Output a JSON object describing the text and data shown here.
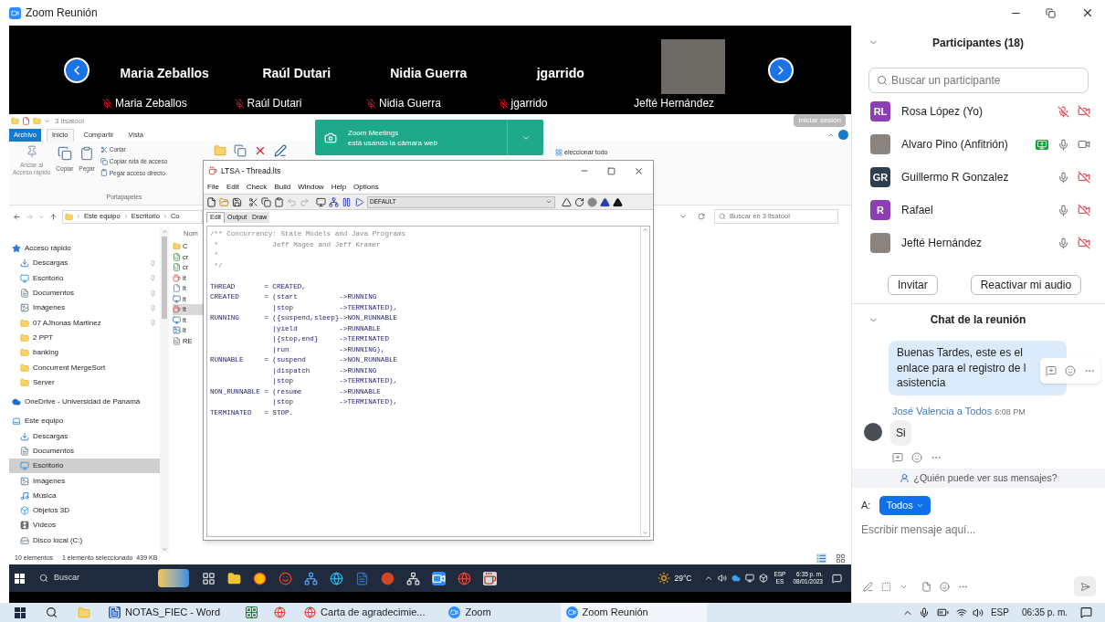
{
  "window": {
    "title": "Zoom Reunión"
  },
  "video_strip": {
    "tiles": [
      {
        "kind": "name",
        "name": "Maria Zeballos",
        "label": "Maria Zeballos",
        "muted": true
      },
      {
        "kind": "name",
        "name": "Raúl Dutari",
        "label": "Raúl Dutari",
        "muted": true
      },
      {
        "kind": "name",
        "name": "Nidia Guerra",
        "label": "Nidia Guerra",
        "muted": true
      },
      {
        "kind": "name",
        "name": "jgarrido",
        "label": "jgarrido",
        "muted": true
      },
      {
        "kind": "video",
        "label": "Jefté Hernández",
        "muted": false
      }
    ]
  },
  "shared_screen": {
    "explorer": {
      "title": "3 ltsatool",
      "ribbon_tabs": [
        {
          "label": "Archivo",
          "kind": "file",
          "selected": false
        },
        {
          "label": "Inicio",
          "kind": "tab",
          "selected": true
        },
        {
          "label": "Compartir",
          "kind": "tab",
          "selected": false
        },
        {
          "label": "Vista",
          "kind": "tab",
          "selected": false
        }
      ],
      "clipboard": {
        "pin": "Anclar al\nAcceso rápido",
        "copy": "Copiar",
        "paste": "Pegar",
        "cut": "Cortar",
        "copy_path": "Copiar ruta de acceso",
        "paste_shortcut": "Pegar acceso directo",
        "group": "Portapapeles"
      },
      "select_all": "eleccionar todo",
      "sign_in": "Iniciar sesión",
      "address": [
        "Este equipo",
        "Escritorio",
        "Co"
      ],
      "search_placeholder": "Buscar en 3 ltsatool",
      "nav": [
        {
          "label": "Acceso rápido",
          "kind": "star",
          "pinned": false,
          "selected": false,
          "children": [
            {
              "label": "Descargas",
              "kind": "download",
              "pinned": true,
              "selected": false
            },
            {
              "label": "Escritorio",
              "kind": "desktop",
              "pinned": true,
              "selected": false
            },
            {
              "label": "Documentos",
              "kind": "document",
              "pinned": true,
              "selected": false
            },
            {
              "label": "Imágenes",
              "kind": "image",
              "pinned": true,
              "selected": false
            },
            {
              "label": "07 AJhonas Martinez",
              "kind": "folder",
              "pinned": true,
              "selected": false
            },
            {
              "label": "2 PPT",
              "kind": "folder",
              "pinned": false,
              "selected": false
            },
            {
              "label": "banking",
              "kind": "folder",
              "pinned": false,
              "selected": false
            },
            {
              "label": "Concurrent MergeSort",
              "kind": "folder",
              "pinned": false,
              "selected": false
            },
            {
              "label": "Server",
              "kind": "folder",
              "pinned": false,
              "selected": false
            }
          ]
        },
        {
          "label": "OneDrive - Universidad de Panamá",
          "kind": "cloud",
          "pinned": false,
          "selected": false
        },
        {
          "label": "Este equipo",
          "kind": "pc",
          "pinned": false,
          "selected": false,
          "children": [
            {
              "label": "Descargas",
              "kind": "download",
              "pinned": false,
              "selected": false
            },
            {
              "label": "Documentos",
              "kind": "document",
              "pinned": false,
              "selected": false
            },
            {
              "label": "Escritorio",
              "kind": "desktop",
              "pinned": false,
              "selected": true
            },
            {
              "label": "Imágenes",
              "kind": "image",
              "pinned": false,
              "selected": false
            },
            {
              "label": "Música",
              "kind": "music",
              "pinned": false,
              "selected": false
            },
            {
              "label": "Objetos 3D",
              "kind": "objects",
              "pinned": false,
              "selected": false
            },
            {
              "label": "Vídeos",
              "kind": "video",
              "pinned": false,
              "selected": false
            },
            {
              "label": "Disco local (C:)",
              "kind": "drive",
              "pinned": false,
              "selected": false
            }
          ]
        }
      ],
      "files": {
        "header": "Nom",
        "rows": [
          {
            "text": "C",
            "kind": "folder",
            "selected": false
          },
          {
            "text": "cr",
            "kind": "script",
            "selected": false
          },
          {
            "text": "cr",
            "kind": "script",
            "selected": false
          },
          {
            "text": "lt",
            "kind": "java",
            "selected": false
          },
          {
            "text": "lt",
            "kind": "file",
            "selected": false
          },
          {
            "text": "lt",
            "kind": "exe",
            "selected": false
          },
          {
            "text": "lt",
            "kind": "java",
            "selected": true
          },
          {
            "text": "lt",
            "kind": "exe",
            "selected": false
          },
          {
            "text": "lt",
            "kind": "image",
            "selected": false
          },
          {
            "text": "RE",
            "kind": "text",
            "selected": false
          }
        ]
      },
      "status": [
        "10 elementos",
        "1 elemento seleccionado  439 KB"
      ]
    },
    "notification": {
      "title": "Zoom Meetings",
      "text": "está usando la cámara web"
    },
    "ltsa": {
      "title": "LTSA - Thread.lts",
      "menu": [
        "File",
        "Edit",
        "Check",
        "Build",
        "Window",
        "Help",
        "Options"
      ],
      "target": "DEFAULT",
      "tabs": [
        {
          "label": "Edit",
          "selected": true
        },
        {
          "label": "Output",
          "selected": false
        },
        {
          "label": "Draw",
          "selected": false
        }
      ],
      "comment_lines": [
        "/** Concurrency: State Models and Java Programs",
        " *             Jeff Magee and Jeff Kramer",
        " *",
        " */"
      ],
      "code_lines": [
        "THREAD       = CREATED,",
        "CREATED      = (start          ->RUNNING",
        "               |stop           ->TERMINATED),",
        "RUNNING      = ({suspend,sleep}->NON_RUNNABLE",
        "               |yield          ->RUNNABLE",
        "               |{stop,end}     ->TERMINATED",
        "               |run            ->RUNNING),",
        "RUNNABLE     = (suspend        ->NON_RUNNABLE",
        "               |dispatch       ->RUNNING",
        "               |stop           ->TERMINATED),",
        "NON_RUNNABLE = (resume         ->RUNNABLE",
        "               |stop           ->TERMINATED),",
        "TERMINATED   = STOP."
      ]
    },
    "taskbar": {
      "search": "Buscar",
      "weather": "29°C",
      "lang": "ESP",
      "region": "ES",
      "time": "6:35 p. m.",
      "date": "08/01/2023"
    }
  },
  "participants": {
    "title": "Participantes (18)",
    "search_placeholder": "Buscar un participante",
    "rows": [
      {
        "name": "Rosa López (Yo)",
        "kind": "initials",
        "initials": "RL",
        "color": "#8c3fb5",
        "sharing": false,
        "muted": true,
        "camera_off": true
      },
      {
        "name": "Alvaro Pino (Anfitrión)",
        "kind": "photo",
        "sharing": true,
        "muted": false,
        "camera_off": false
      },
      {
        "name": "Guillermo R Gonzalez",
        "kind": "initials",
        "initials": "GR",
        "color": "#2e3d50",
        "sharing": false,
        "muted": false,
        "camera_off": true
      },
      {
        "name": "Rafael",
        "kind": "initials",
        "initials": "R",
        "color": "#8c3fb5",
        "sharing": false,
        "muted": false,
        "camera_off": true
      },
      {
        "name": "Jefté Hernández",
        "kind": "photo",
        "sharing": false,
        "muted": false,
        "camera_off": true
      }
    ],
    "buttons": [
      "Invitar",
      "Reactivar mi audio"
    ]
  },
  "chat": {
    "title": "Chat de la reunión",
    "messages": [
      {
        "kind": "own",
        "text": "Buenas Tardes, este es el\nenlace para el registro de l\nasistencia"
      },
      {
        "kind": "incoming",
        "sender": "José Valencia",
        "connector": "a",
        "recipient": "Todos",
        "time": "6:08 PM",
        "text": "Si"
      }
    ],
    "visibility": "¿Quién puede ver sus mensajes?",
    "to_label": "A:",
    "recipient": "Todos",
    "placeholder": "Escribir mensaje aquí..."
  },
  "taskbar": {
    "items": [
      {
        "kind": "word",
        "label": "NOTAS_FIEC - Word",
        "selected": false
      },
      {
        "kind": "browser",
        "label": "Carta de agradecimie...",
        "selected": false
      },
      {
        "kind": "zoom",
        "label": "Zoom",
        "selected": false
      },
      {
        "kind": "zoom",
        "label": "Zoom Reunión",
        "selected": true
      }
    ],
    "lang": "ESP",
    "time": "06:35 p. m."
  }
}
